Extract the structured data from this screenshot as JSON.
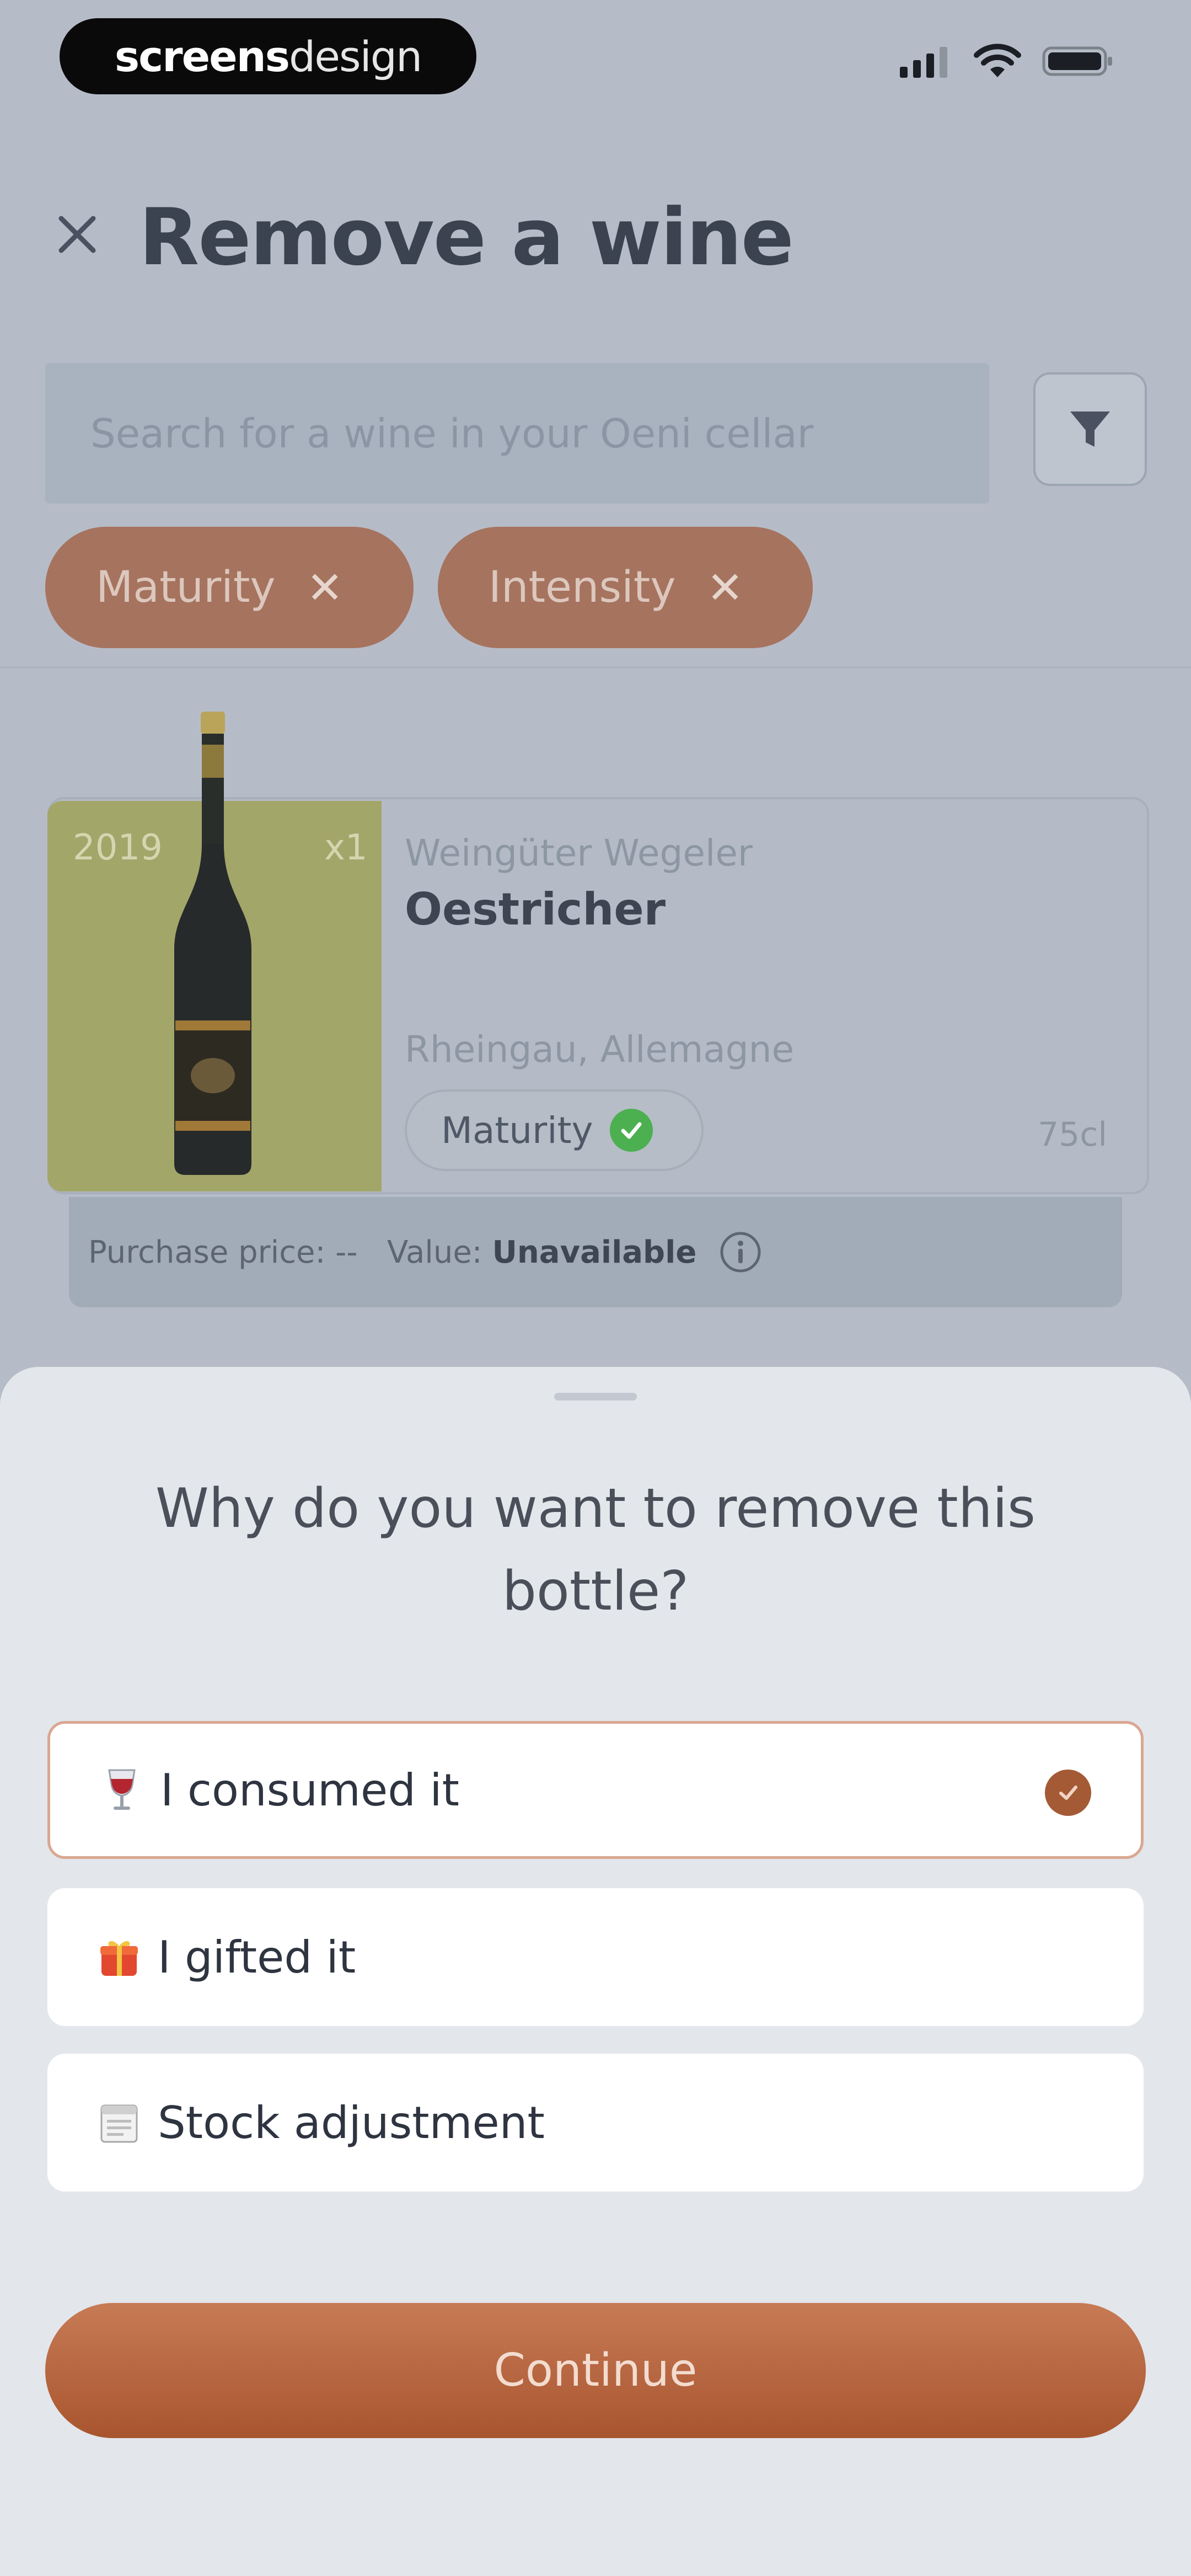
{
  "status_bar": {
    "brand_bold": "screens",
    "brand_light": "design"
  },
  "header": {
    "title": "Remove a wine"
  },
  "search": {
    "placeholder": "Search for a wine in your Oeni cellar"
  },
  "filters": [
    {
      "label": "Maturity"
    },
    {
      "label": "Intensity"
    }
  ],
  "wine": {
    "vintage": "2019",
    "quantity": "x1",
    "producer": "Weingüter Wegeler",
    "name": "Oestricher",
    "region": "Rheingau, Allemagne",
    "maturity_label": "Maturity",
    "volume": "75cl",
    "thumb_color": "#a3a669"
  },
  "price": {
    "purchase_label": "Purchase price:",
    "purchase_value": "--",
    "value_label": "Value:",
    "value_value": "Unavailable"
  },
  "sheet": {
    "question": "Why do you want to remove this bottle?",
    "options": [
      {
        "icon": "wine-glass-icon",
        "label": "I consumed it",
        "selected": true
      },
      {
        "icon": "gift-icon",
        "label": "I gifted it",
        "selected": false
      },
      {
        "icon": "calendar-icon",
        "label": "Stock adjustment",
        "selected": false
      }
    ],
    "continue_label": "Continue"
  },
  "colors": {
    "accent": "#a8552f",
    "chip": "#a6735f"
  }
}
